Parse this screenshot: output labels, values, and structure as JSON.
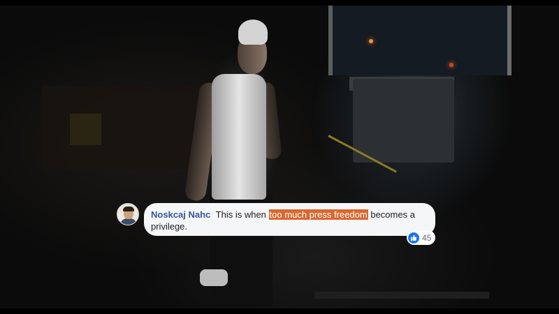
{
  "comment": {
    "author": "Noskcaj Nahc",
    "text_before": "This is when",
    "highlight": "too much press freedom",
    "text_after": "becomes a privilege.",
    "highlight_color": "#d9682f",
    "author_color": "#385898",
    "reaction": {
      "icon": "like-icon",
      "count": "45",
      "color": "#1877f2"
    }
  }
}
